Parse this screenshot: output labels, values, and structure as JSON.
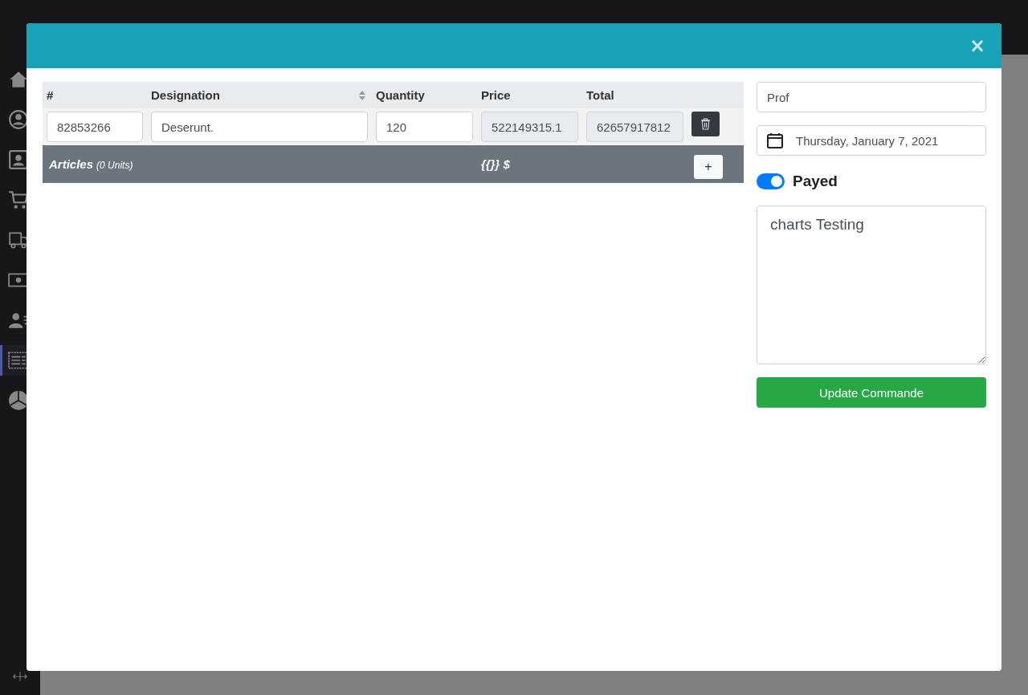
{
  "sidebar": {
    "items": [
      {
        "kind": "home",
        "selected": false
      },
      {
        "kind": "user-circle",
        "selected": false
      },
      {
        "kind": "contact",
        "selected": false
      },
      {
        "kind": "cart",
        "selected": false
      },
      {
        "kind": "truck",
        "selected": false
      },
      {
        "kind": "money",
        "selected": false
      },
      {
        "kind": "users",
        "selected": false
      },
      {
        "kind": "receipt",
        "selected": true
      },
      {
        "kind": "pie",
        "selected": false
      }
    ]
  },
  "modal": {
    "close": "×",
    "table": {
      "columns": [
        {
          "label": "#",
          "sortable": false
        },
        {
          "label": "Designation",
          "sortable": true
        },
        {
          "label": "Quantity",
          "sortable": false
        },
        {
          "label": "Price",
          "sortable": false
        },
        {
          "label": "Total",
          "sortable": false
        }
      ],
      "rows": [
        {
          "number": "82853266",
          "designation": "Deserunt.",
          "quantity": "120",
          "price": "522149315.1",
          "total": "62657917812"
        }
      ],
      "footer": {
        "label": "Articles",
        "units": "(0 Units)",
        "sum": "{{}} $",
        "add": "+"
      }
    },
    "client": "Prof",
    "date": "Thursday, January 7, 2021",
    "payed": {
      "label": "Payed",
      "on": true
    },
    "notes": "charts Testing",
    "submit": "Update Commande"
  }
}
